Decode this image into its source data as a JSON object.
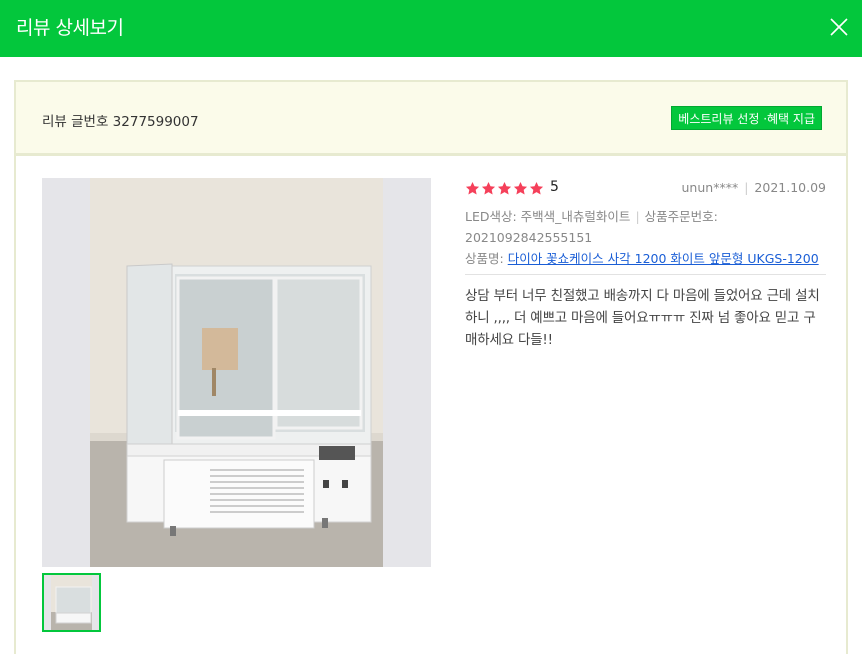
{
  "header": {
    "title": "리뷰 상세보기",
    "close_icon": "close-icon"
  },
  "notice": {
    "label": "리뷰 글번호 3277599007",
    "badge": "베스트리뷰 선정 ·혜택 지급"
  },
  "review": {
    "rating": 5,
    "rating_text": "5",
    "author": "unun****",
    "date": "2021.10.09",
    "option_1": "LED색상: 주백색_내츄럴화이트",
    "option_2": "상품주문번호:",
    "order_number": "2021092842555151",
    "product_label": "상품명:",
    "product_name": "다이아 꽃쇼케이스 사각 1200 화이트 앞문형 UKGS-1200",
    "body": "상담 부터 너무 친절했고 배송까지 다 마음에 들었어요 근데 설치하니 ,,,, 더 예쁘고 마음에 들어요ㅠㅠㅠ 진짜 넘 좋아요 믿고 구매하세요 다들!!"
  },
  "colors": {
    "brand_green": "#03c73c",
    "star": "#f5405a",
    "link": "#1a5ed6"
  }
}
